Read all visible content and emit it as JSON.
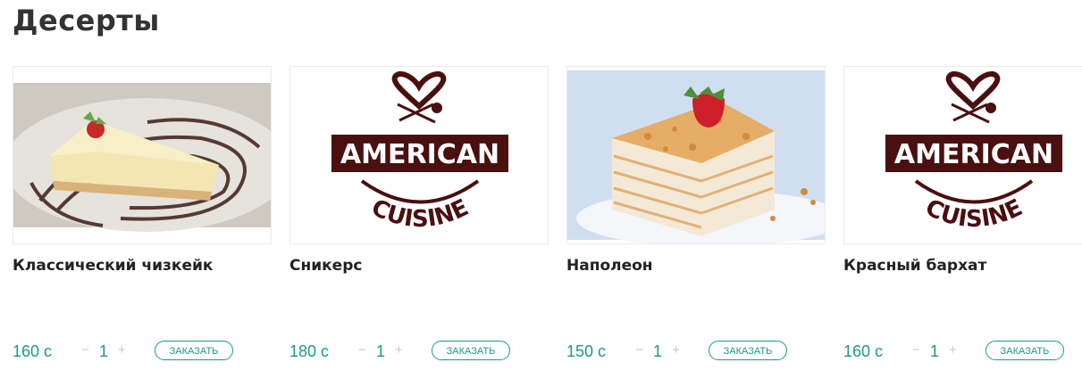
{
  "section": {
    "title": "Десерты"
  },
  "products": [
    {
      "name": "Классический чизкейк",
      "price": "160 с",
      "qty": "1",
      "minus": "−",
      "plus": "+",
      "order_label": "ЗАКАЗАТЬ",
      "image": "cheesecake-photo"
    },
    {
      "name": "Сникерс",
      "price": "180 с",
      "qty": "1",
      "minus": "−",
      "plus": "+",
      "order_label": "ЗАКАЗАТЬ",
      "image": "american-cuisine-logo"
    },
    {
      "name": "Наполеон",
      "price": "150 с",
      "qty": "1",
      "minus": "−",
      "plus": "+",
      "order_label": "ЗАКАЗАТЬ",
      "image": "napoleon-cake-photo"
    },
    {
      "name": "Красный бархат",
      "price": "160 с",
      "qty": "1",
      "minus": "−",
      "plus": "+",
      "order_label": "ЗАКАЗАТЬ",
      "image": "american-cuisine-logo"
    }
  ],
  "logo": {
    "banner": "AMERICAN",
    "arc": "CUISINE"
  },
  "colors": {
    "accent": "#1a9a8b",
    "logo": "#4a0f0f"
  }
}
